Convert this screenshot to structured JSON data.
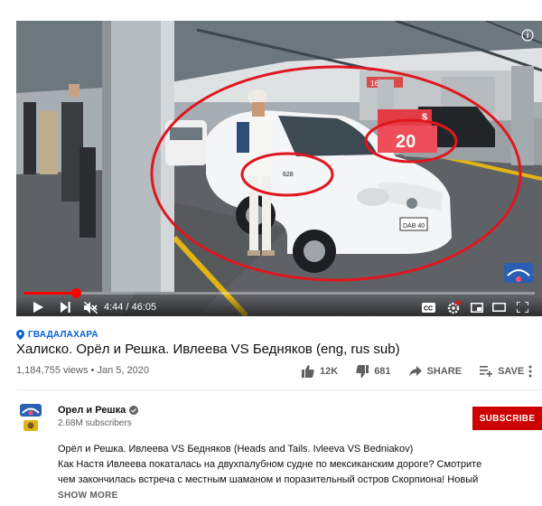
{
  "player": {
    "current_time": "4:44",
    "separator": " / ",
    "duration": "46:05",
    "progress": 0.103,
    "overlay_price_symbol": "$",
    "overlay_price": "20",
    "car_number": "628",
    "plate": "DAB 40"
  },
  "video": {
    "location": "ГВАДАЛАХАРА",
    "title": "Халиско. Орёл и Решка. Ивлеева VS Бедняков (eng, rus sub)",
    "views": "1,184,755 views",
    "dot": " • ",
    "date": "Jan 5, 2020"
  },
  "actions": {
    "likes": "12K",
    "dislikes": "681",
    "share": "SHARE",
    "save": "SAVE"
  },
  "channel": {
    "name": "Орел и Решка",
    "subscribers": "2.68M subscribers",
    "subscribe_label": "SUBSCRIBE"
  },
  "description": {
    "lines": [
      "Орёл и Решка. Ивлеева VS Бедняков (Heads and Tails. Ivleeva VS Bedniakov)",
      "Как Настя Ивлеева покаталась на двухпалубном судне по мексиканским дорогe? Смотрите",
      "чем закончилась встреча с местным шаманом и поразительный остров Скорпиона! Новый"
    ],
    "show_more": "SHOW MORE"
  },
  "colors": {
    "accent_red": "#ff0000",
    "subscribe_bg": "#cc0000",
    "link_blue": "#065fd4",
    "muted_text": "#606060"
  }
}
